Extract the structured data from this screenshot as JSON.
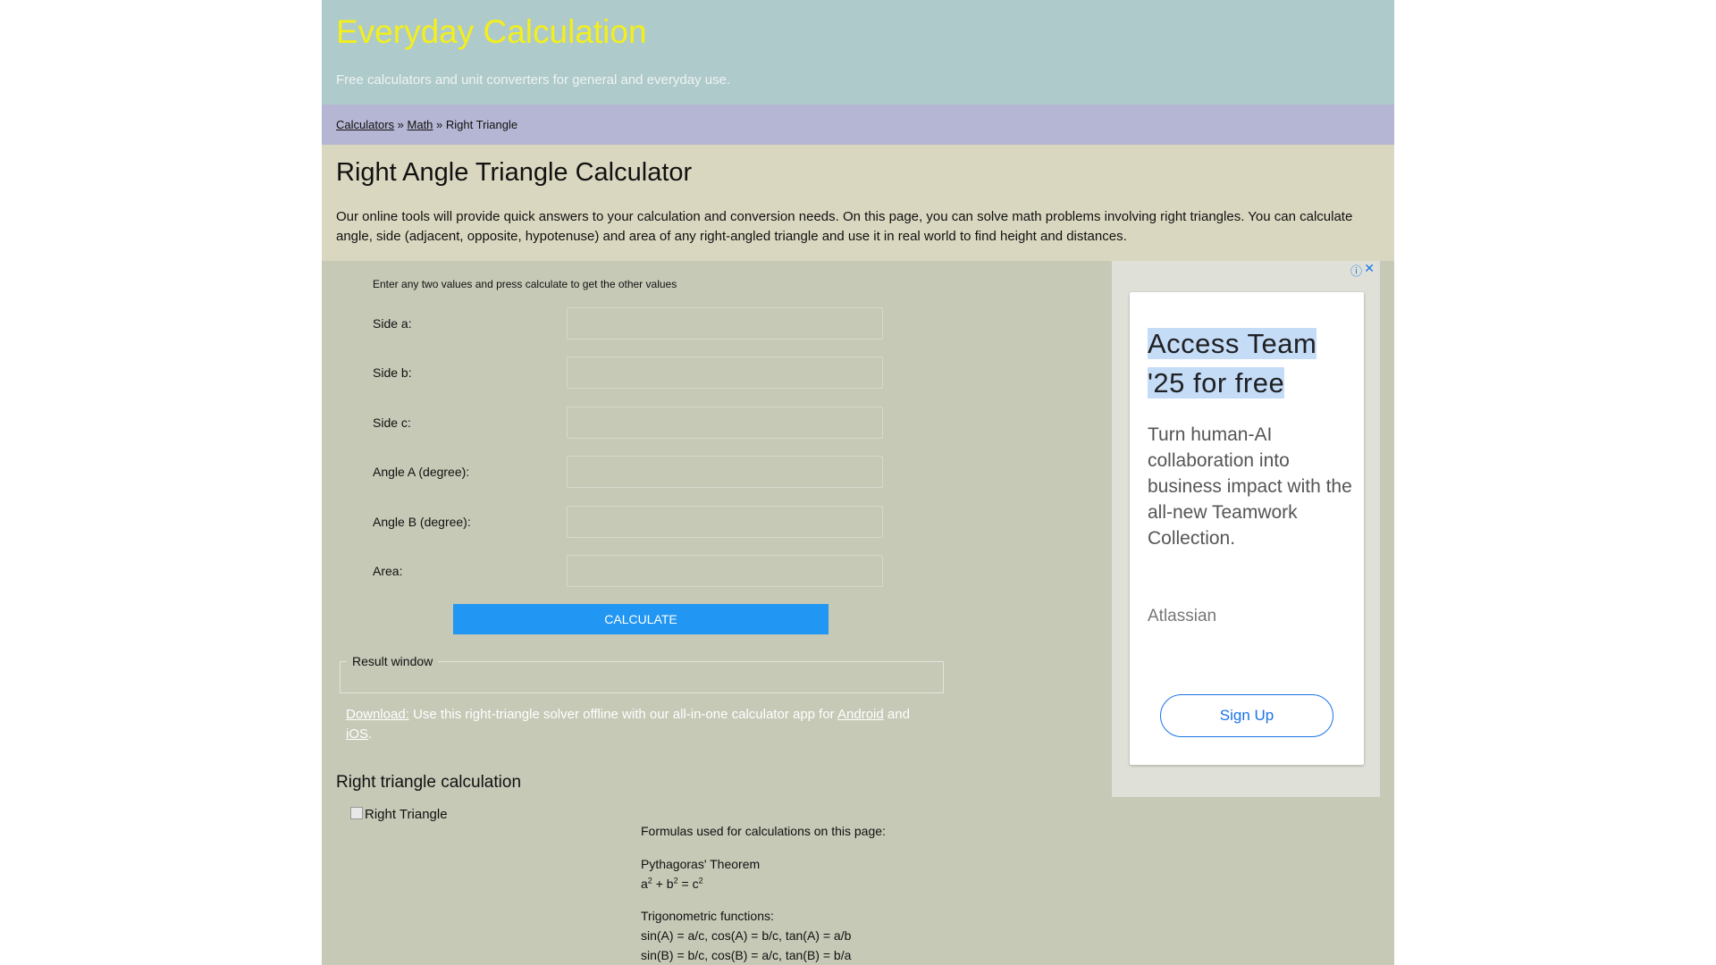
{
  "header": {
    "site_title": "Everyday Calculation",
    "tagline": "Free calculators and unit converters for general and everyday use."
  },
  "breadcrumb": {
    "items": [
      "Calculators",
      "Math"
    ],
    "separator": "»",
    "current": "Right Triangle"
  },
  "intro": {
    "title": "Right Angle Triangle Calculator",
    "text": "Our online tools will provide quick answers to your calculation and conversion needs. On this page, you can solve math problems involving right triangles. You can calculate angle, side (adjacent, opposite, hypotenuse) and area of any right-angled triangle and use it in real world to find height and distances."
  },
  "calculator": {
    "instruction": "Enter any two values and press calculate to get the other values",
    "fields": [
      {
        "label": "Side a:",
        "value": ""
      },
      {
        "label": "Side b:",
        "value": ""
      },
      {
        "label": "Side c:",
        "value": ""
      },
      {
        "label": "Angle A (degree):",
        "value": ""
      },
      {
        "label": "Angle B (degree):",
        "value": ""
      },
      {
        "label": "Area:",
        "value": ""
      }
    ],
    "button_label": "CALCULATE",
    "result_legend": "Result window"
  },
  "download": {
    "link_label": "Download:",
    "text": "Use this right-triangle solver offline with our all-in-one calculator app for",
    "android_label": "Android",
    "and": "and",
    "ios_label": "iOS",
    "end": "."
  },
  "section": {
    "heading": "Right triangle calculation",
    "image_alt": "Right Triangle"
  },
  "formulas": {
    "intro": "Formulas used for calculations on this page:",
    "pythagoras_title": "Pythagoras' Theorem",
    "pythagoras": {
      "a": "a",
      "b": "b",
      "c": "c",
      "exp": "2",
      "plus": "+",
      "eq": "="
    },
    "trig_title": "Trigonometric functions:",
    "trig_a": "sin(A) = a/c, cos(A) = b/c, tan(A) = a/b",
    "trig_b": "sin(B) = b/c, cos(B) = a/c, tan(B) = b/a"
  },
  "ad": {
    "info_icon": "ⓘ",
    "close_icon": "✕",
    "headline": "Access Team '25 for free",
    "body": "Turn human-AI collaboration into business impact with the all-new Teamwork Collection.",
    "advertiser": "Atlassian",
    "cta": "Sign Up"
  },
  "colors": {
    "header_bg": "#afcacb",
    "title_yellow": "#f3ef1c",
    "breadcrumb_bg": "#b5b6d3",
    "intro_bg": "#dad7c0",
    "page_bg": "#c5c9b6",
    "button_blue": "#2196f3"
  }
}
